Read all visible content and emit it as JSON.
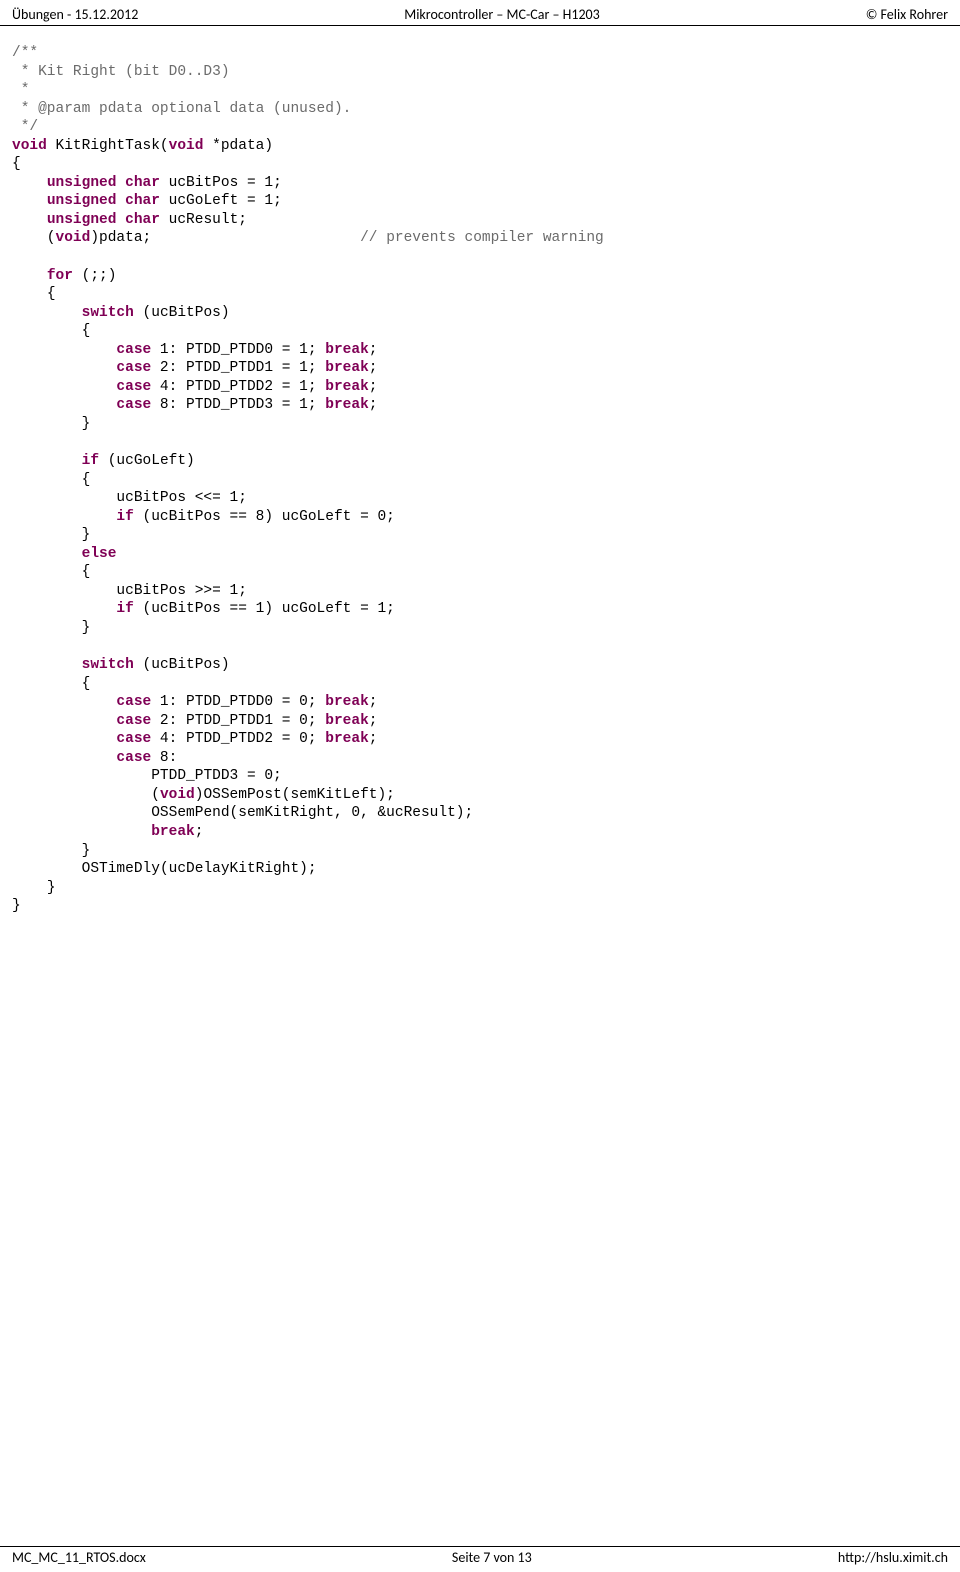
{
  "header": {
    "left": "Übungen - 15.12.2012",
    "center": "Mikrocontroller – MC-Car – H1203",
    "right": "© Felix Rohrer"
  },
  "footer": {
    "left": "MC_MC_11_RTOS.docx",
    "center": "Seite 7 von 13",
    "right": "http://hslu.ximit.ch"
  },
  "code": {
    "c1": "/**",
    "c2": " * Kit Right (bit D0..D3)",
    "c3": " *",
    "c4": " * @param pdata optional data (unused).",
    "c5": " */",
    "k_void": "void",
    "t_fn": " KitRightTask(",
    "t_fnarg": " *pdata)",
    "brace_o": "{",
    "k_uns": "unsigned",
    "k_char": "char",
    "v_bpos": " ucBitPos = 1;",
    "v_goleft": " ucGoLeft = 1;",
    "v_res": " ucResult;",
    "v_pdata": ")pdata;",
    "cmt_warn": "// prevents compiler warning",
    "k_for": "for",
    "t_for": " (;;)",
    "k_switch": "switch",
    "t_sw": " (ucBitPos)",
    "k_case": "case",
    "sw1_c1a": " 1: PTDD_PTDD0 = 1; ",
    "sw1_c2a": " 2: PTDD_PTDD1 = 1; ",
    "sw1_c3a": " 4: PTDD_PTDD2 = 1; ",
    "sw1_c4a": " 8: PTDD_PTDD3 = 1; ",
    "k_break": "break",
    "semi": ";",
    "brace_c": "}",
    "k_if": "if",
    "t_if1": " (ucGoLeft)",
    "body_shl": "ucBitPos <<= 1;",
    "t_if2": " (ucBitPos == 8) ucGoLeft = 0;",
    "k_else": "else",
    "body_shr": "ucBitPos >>= 1;",
    "t_if3": " (ucBitPos == 1) ucGoLeft = 1;",
    "sw2_c1a": " 1: PTDD_PTDD0 = 0; ",
    "sw2_c2a": " 2: PTDD_PTDD1 = 0; ",
    "sw2_c3a": " 4: PTDD_PTDD2 = 0; ",
    "sw2_c4a": " 8:",
    "sw2_l1": "PTDD_PTDD3 = 0;",
    "sw2_l2a": "(",
    "sw2_l2b": ")OSSemPost(semKitLeft);",
    "sw2_l3": "OSSemPend(semKitRight, 0, &ucResult);",
    "t_dly": "OSTimeDly(ucDelayKitRight);"
  }
}
